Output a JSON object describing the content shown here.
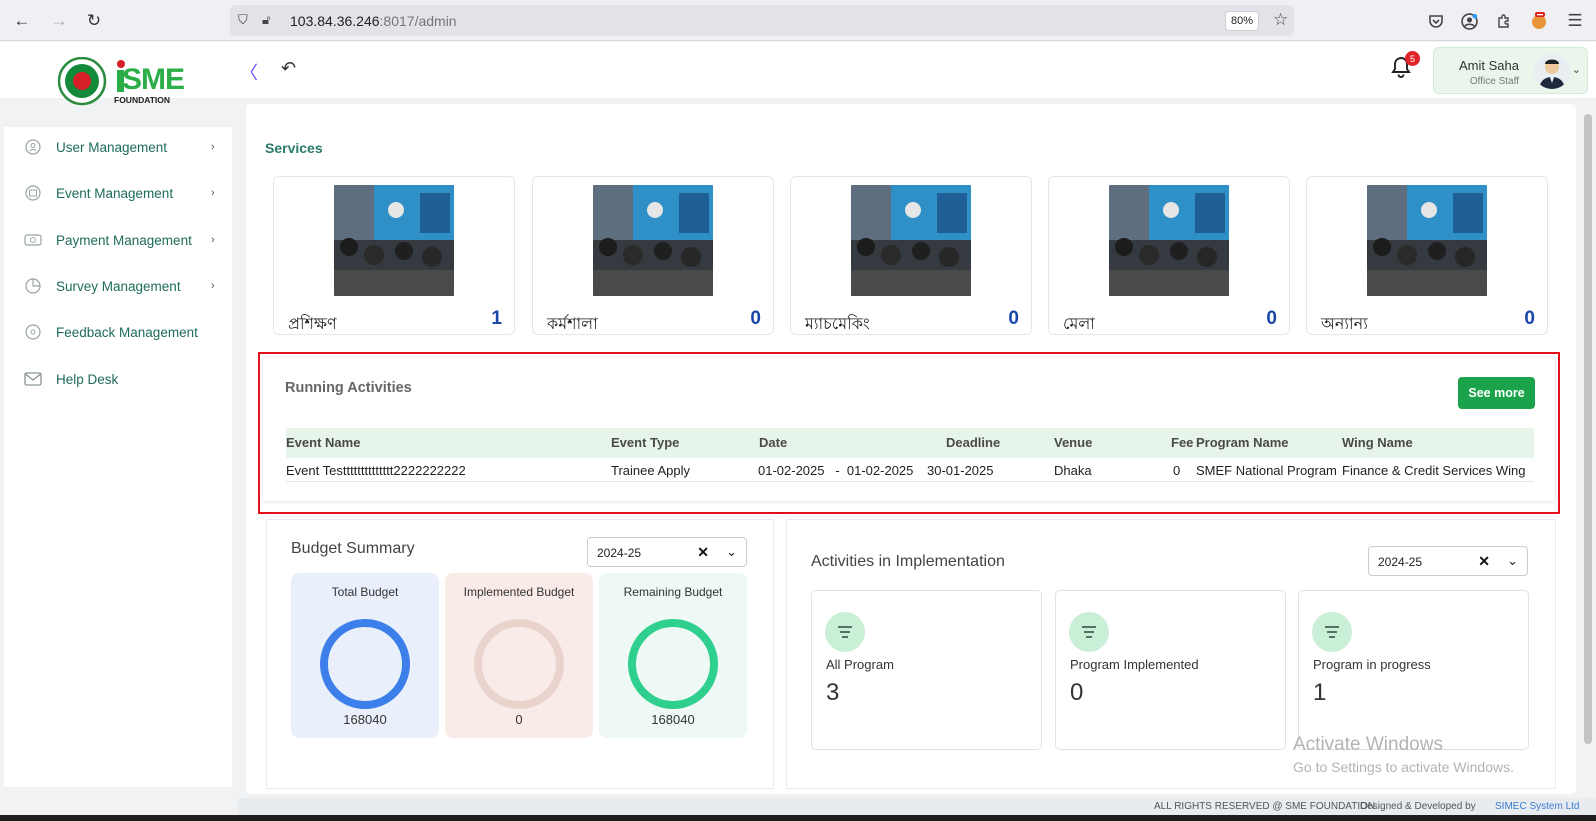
{
  "browser": {
    "url_host": "103.84.36.246",
    "url_rest": ":8017/admin",
    "zoom": "80%"
  },
  "header": {
    "logo_text": "SME",
    "logo_sub": "FOUNDATION",
    "notification_count": "5",
    "user_name": "Amit Saha",
    "user_role": "Office Staff"
  },
  "sidebar": {
    "items": [
      {
        "label": "User Management",
        "icon": "user-shield-icon",
        "has_arrow": true
      },
      {
        "label": "Event Management",
        "icon": "event-icon",
        "has_arrow": true
      },
      {
        "label": "Payment Management",
        "icon": "payment-icon",
        "has_arrow": true
      },
      {
        "label": "Survey Management",
        "icon": "pie-chart-icon",
        "has_arrow": true
      },
      {
        "label": "Feedback Management",
        "icon": "feedback-icon",
        "has_arrow": false
      },
      {
        "label": "Help Desk",
        "icon": "envelope-icon",
        "has_arrow": false
      }
    ],
    "arrow": "›"
  },
  "services": {
    "title": "Services",
    "cards": [
      {
        "name": "প্রশিক্ষণ",
        "count": "1"
      },
      {
        "name": "কর্মশালা",
        "count": "0"
      },
      {
        "name": "ম্যাচমেকিং",
        "count": "0"
      },
      {
        "name": "মেলা",
        "count": "0"
      },
      {
        "name": "অন্যান্য",
        "count": "0"
      }
    ]
  },
  "running": {
    "title": "Running Activities",
    "see_more": "See more",
    "columns": [
      "Event Name",
      "Event Type",
      "Date",
      "Deadline",
      "Venue",
      "Fee",
      "Program Name",
      "Wing Name"
    ],
    "rows": [
      [
        "Event Testttttttttttttt2222222222",
        "Trainee Apply",
        "01-02-2025   -  01-02-2025",
        "30-01-2025",
        "Dhaka",
        "0",
        "SMEF National Program",
        "Finance & Credit Services Wing"
      ]
    ]
  },
  "budget": {
    "title": "Budget Summary",
    "fiscal_year": "2024-25",
    "items": [
      {
        "label": "Total Budget",
        "value": "168040",
        "bg": "#eaf0fb",
        "ring": "#3d7fea"
      },
      {
        "label": "Implemented Budget",
        "value": "0",
        "bg": "#f8ebe8",
        "ring": "#ead3cd"
      },
      {
        "label": "Remaining Budget",
        "value": "168040",
        "bg": "#eef8f5",
        "ring": "#2fcf8e"
      }
    ]
  },
  "activities": {
    "title": "Activities in Implementation",
    "fiscal_year": "2024-25",
    "stats": [
      {
        "label": "All Program",
        "value": "3"
      },
      {
        "label": "Program Implemented",
        "value": "0"
      },
      {
        "label": "Program in progress",
        "value": "1"
      }
    ]
  },
  "watermark": {
    "line1": "Activate Windows",
    "line2": "Go to Settings to activate Windows."
  },
  "footer": {
    "rights": "ALL RIGHTS RESERVED @ SME FOUNDATION",
    "designed": "Designed & Developed by",
    "company": "SIMEC System Ltd"
  }
}
